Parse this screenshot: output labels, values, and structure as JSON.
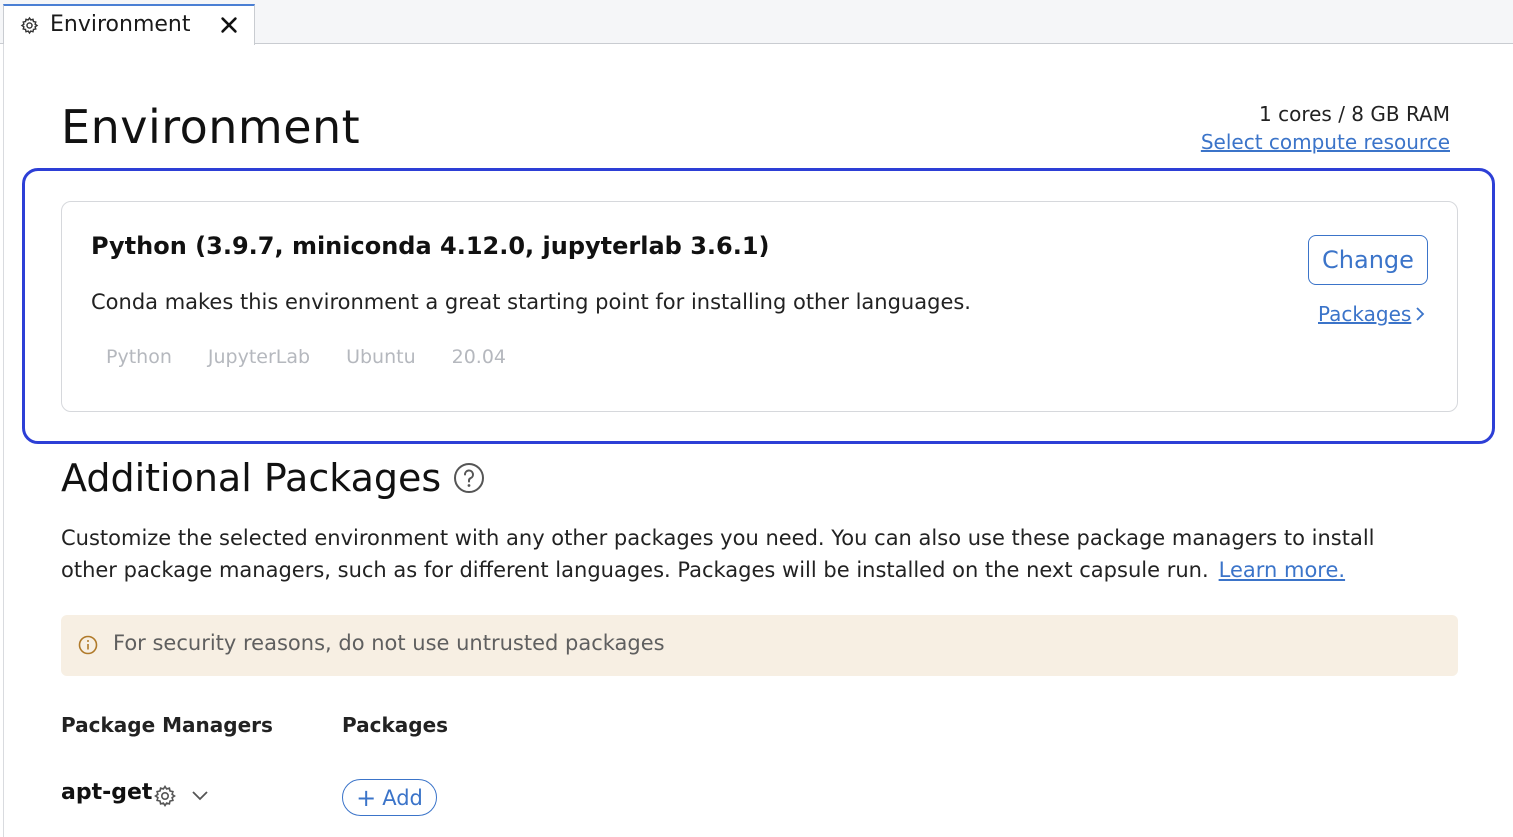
{
  "tab": {
    "label": "Environment"
  },
  "page": {
    "title": "Environment"
  },
  "compute": {
    "spec": "1 cores / 8 GB RAM",
    "link": "Select compute resource"
  },
  "environment": {
    "name": "Python (3.9.7, miniconda 4.12.0, jupyterlab 3.6.1)",
    "description": "Conda makes this environment a great starting point for installing other languages.",
    "tags": [
      "Python",
      "JupyterLab",
      "Ubuntu",
      "20.04"
    ],
    "change_label": "Change",
    "packages_link": "Packages"
  },
  "additional": {
    "title": "Additional Packages",
    "description": "Customize the selected environment with any other packages you need. You can also use these package managers to install other package managers, such as for different languages. Packages will be installed on the next capsule run.",
    "learn_more": "Learn more.",
    "warning": "For security reasons, do not use untrusted packages",
    "col_managers": "Package Managers",
    "col_packages": "Packages",
    "manager": "apt-get",
    "add_label": "Add"
  },
  "colors": {
    "accent": "#3b74c9",
    "focus": "#2d3fd6",
    "warning_bg": "#f7efe3"
  },
  "icons": [
    "gear-icon",
    "close-icon",
    "chevron-right-icon",
    "help-icon",
    "info-icon",
    "chevron-down-icon",
    "plus-icon"
  ]
}
